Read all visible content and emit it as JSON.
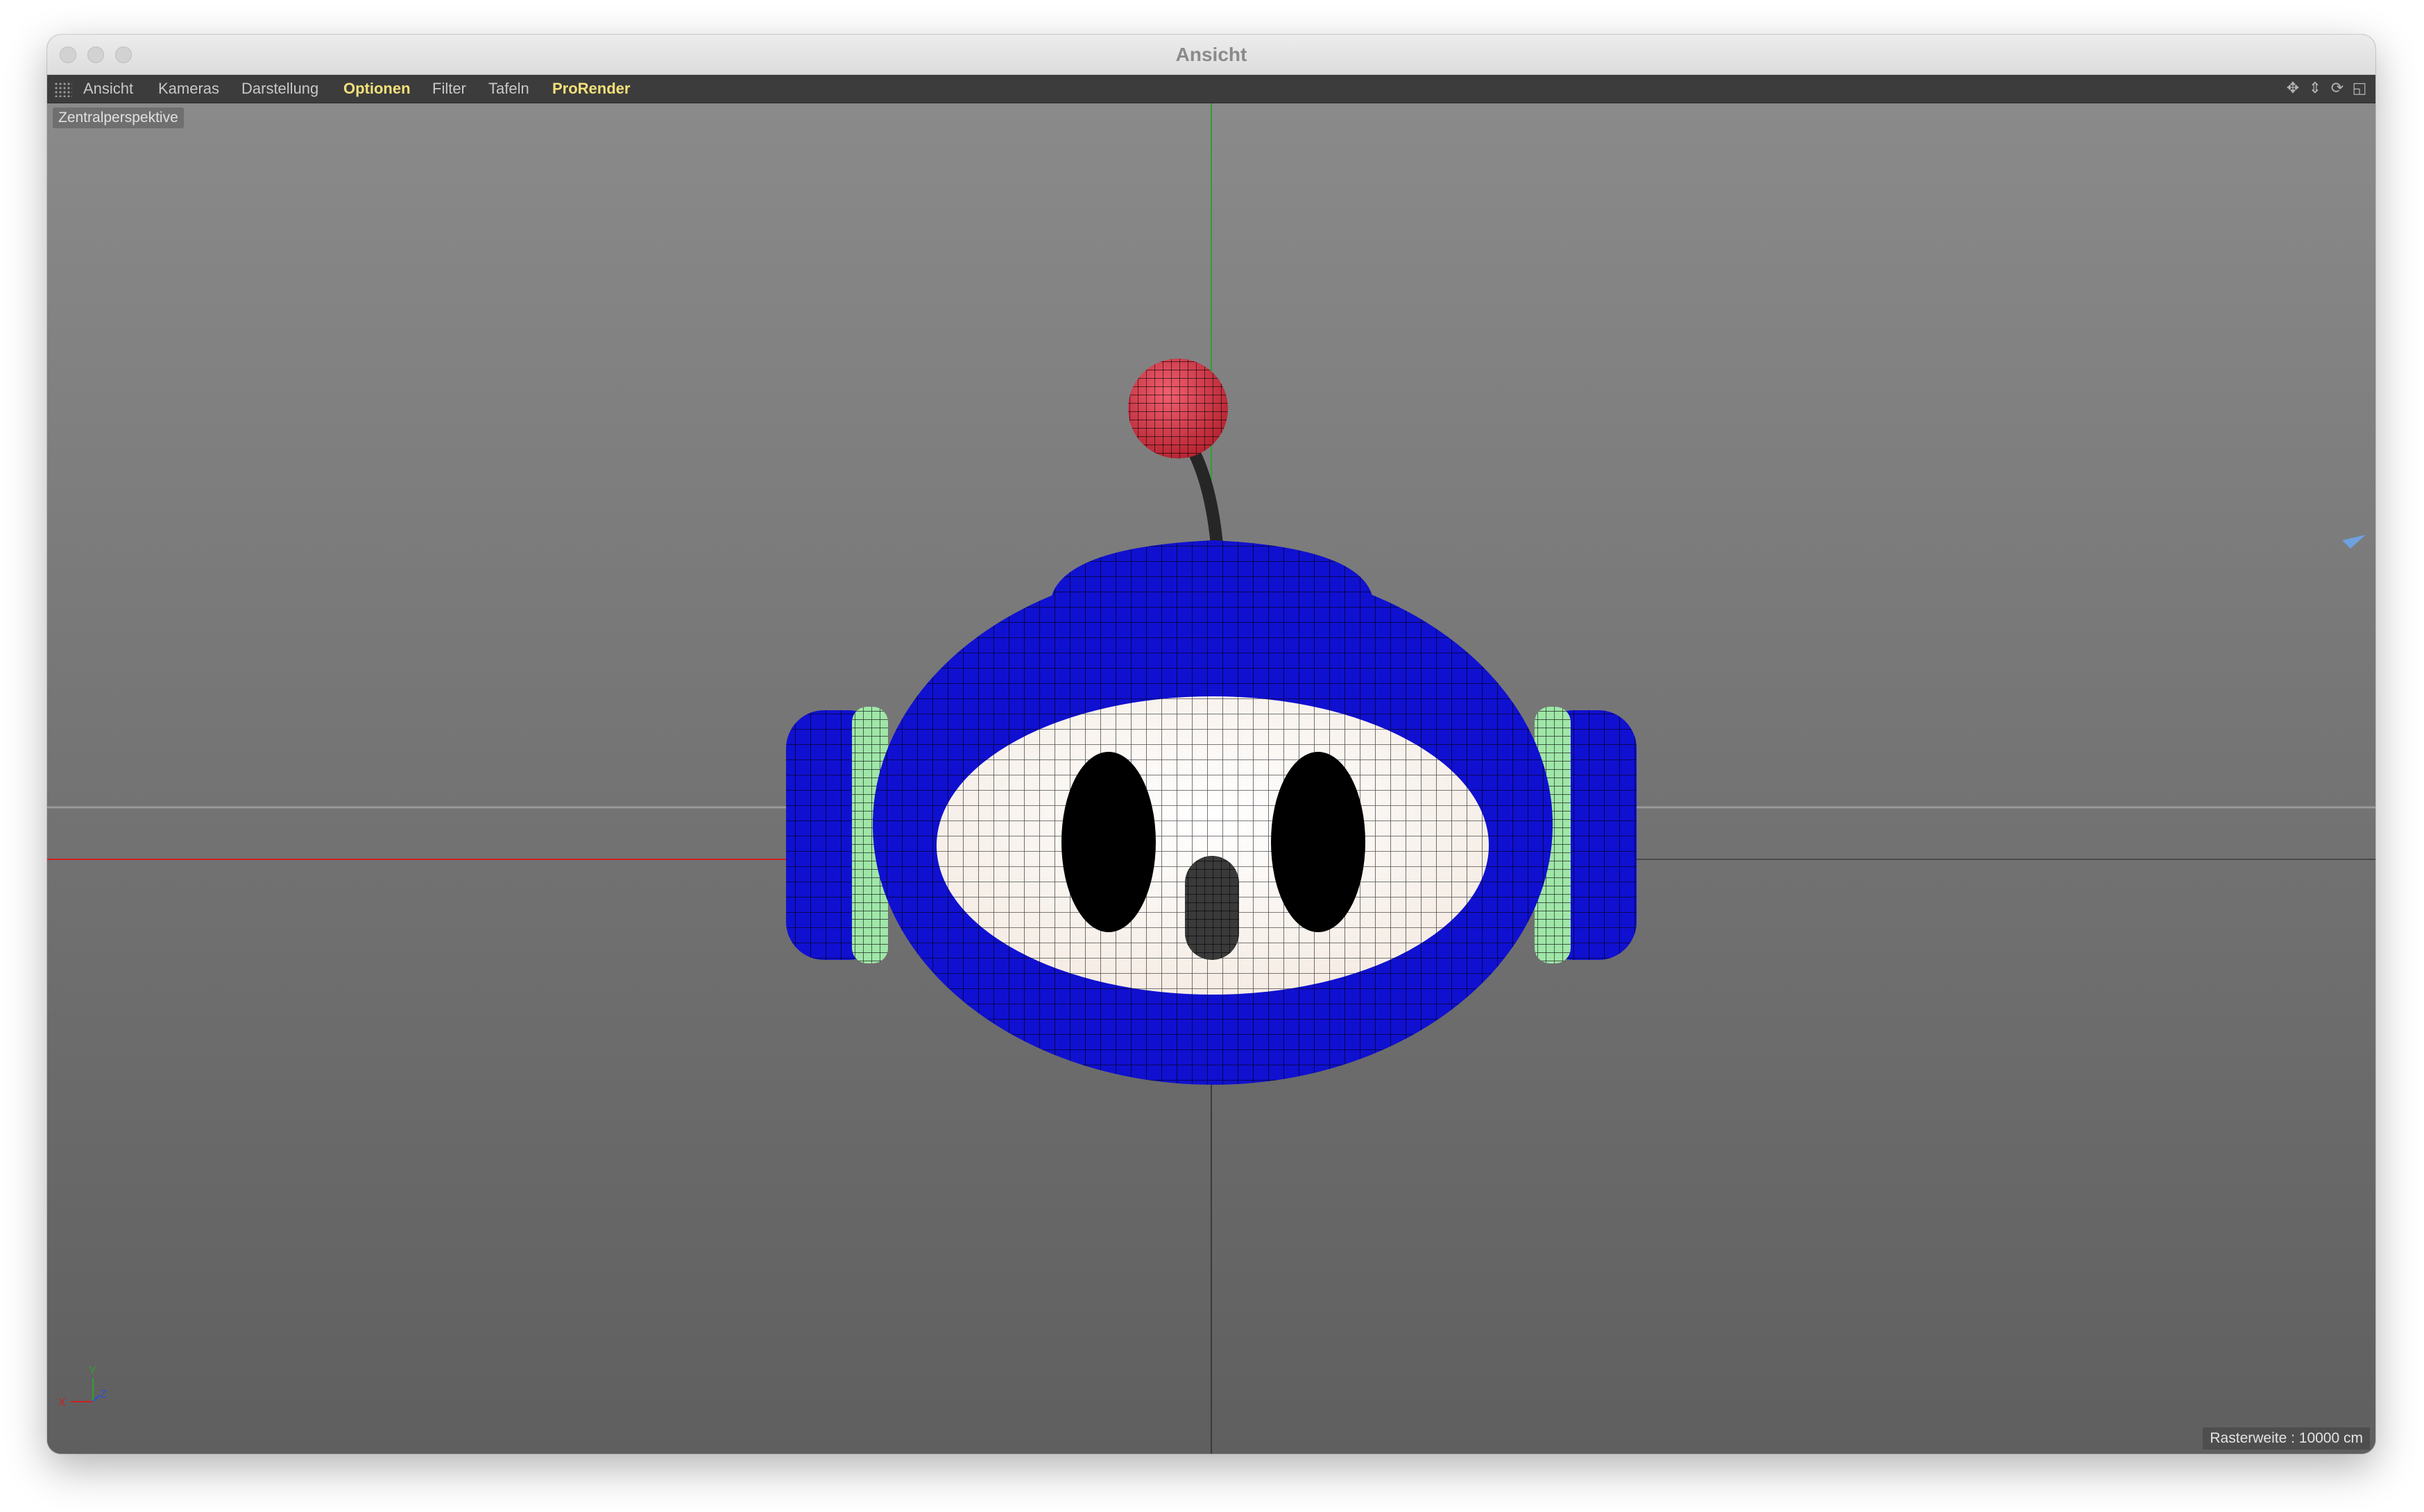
{
  "window": {
    "title": "Ansicht"
  },
  "menu": {
    "items": [
      {
        "label": "Ansicht",
        "highlight": false
      },
      {
        "label": "Kameras",
        "highlight": false
      },
      {
        "label": "Darstellung",
        "highlight": false
      },
      {
        "label": "Optionen",
        "highlight": true
      },
      {
        "label": "Filter",
        "highlight": false
      },
      {
        "label": "Tafeln",
        "highlight": false
      },
      {
        "label": "ProRender",
        "highlight": true
      }
    ],
    "nav_icons": [
      "move-view-icon",
      "dolly-view-icon",
      "rotate-view-icon",
      "maximize-view-icon"
    ]
  },
  "viewport": {
    "projection_label": "Zentralperspektive",
    "grid_status": "Rasterweite : 10000 cm",
    "axes": {
      "x": "X",
      "y": "Y",
      "z": "Z"
    }
  },
  "colors": {
    "body": "#1010d0",
    "face": "#ffffff",
    "eyes": "#000000",
    "antenna_ball": "#d83a48",
    "rings": "#9fe6a8",
    "x_axis": "#cc2020",
    "y_axis": "#30a030",
    "highlight_menu": "#f2e07a"
  }
}
